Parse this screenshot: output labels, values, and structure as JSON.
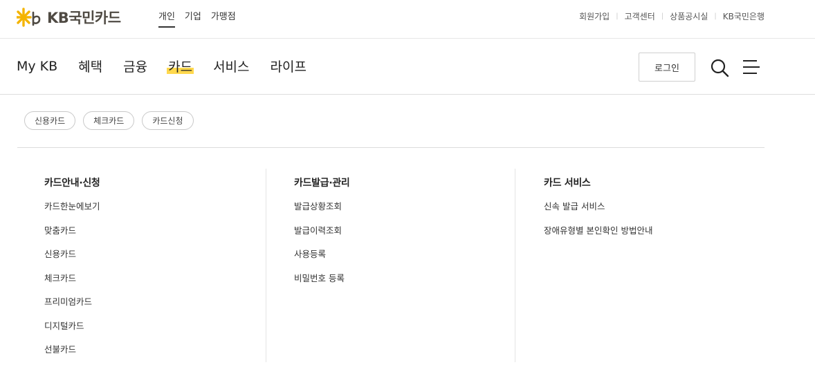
{
  "brand": {
    "name": "KB국민카드"
  },
  "audience_tabs": [
    {
      "label": "개인",
      "active": true
    },
    {
      "label": "기업",
      "active": false
    },
    {
      "label": "가맹점",
      "active": false
    }
  ],
  "utility_links": [
    "회원가입",
    "고객센터",
    "상품공시실",
    "KB국민은행"
  ],
  "main_menu": [
    {
      "label": "My KB",
      "active": false
    },
    {
      "label": "혜택",
      "active": false
    },
    {
      "label": "금융",
      "active": false
    },
    {
      "label": "카드",
      "active": true
    },
    {
      "label": "서비스",
      "active": false
    },
    {
      "label": "라이프",
      "active": false
    }
  ],
  "login_label": "로그인",
  "icons": {
    "search": "search-icon",
    "menu": "hamburger-icon",
    "logo": "star-logo-icon"
  },
  "colors": {
    "accent": "#ffd84d",
    "logo_star": "#f4b400",
    "logo_text": "#4f4a43"
  },
  "chips": [
    "신용카드",
    "체크카드",
    "카드신청"
  ],
  "columns": [
    {
      "title": "카드안내·신청",
      "items": [
        "카드한눈에보기",
        "맞춤카드",
        "신용카드",
        "체크카드",
        "프리미엄카드",
        "디지털카드",
        "선불카드"
      ]
    },
    {
      "title": "카드발급·관리",
      "items": [
        "발급상황조회",
        "발급이력조회",
        "사용등록",
        "비밀번호 등록"
      ]
    },
    {
      "title": "카드 서비스",
      "items": [
        "신속 발급 서비스",
        "장애유형별 본인확인 방법안내"
      ]
    }
  ]
}
